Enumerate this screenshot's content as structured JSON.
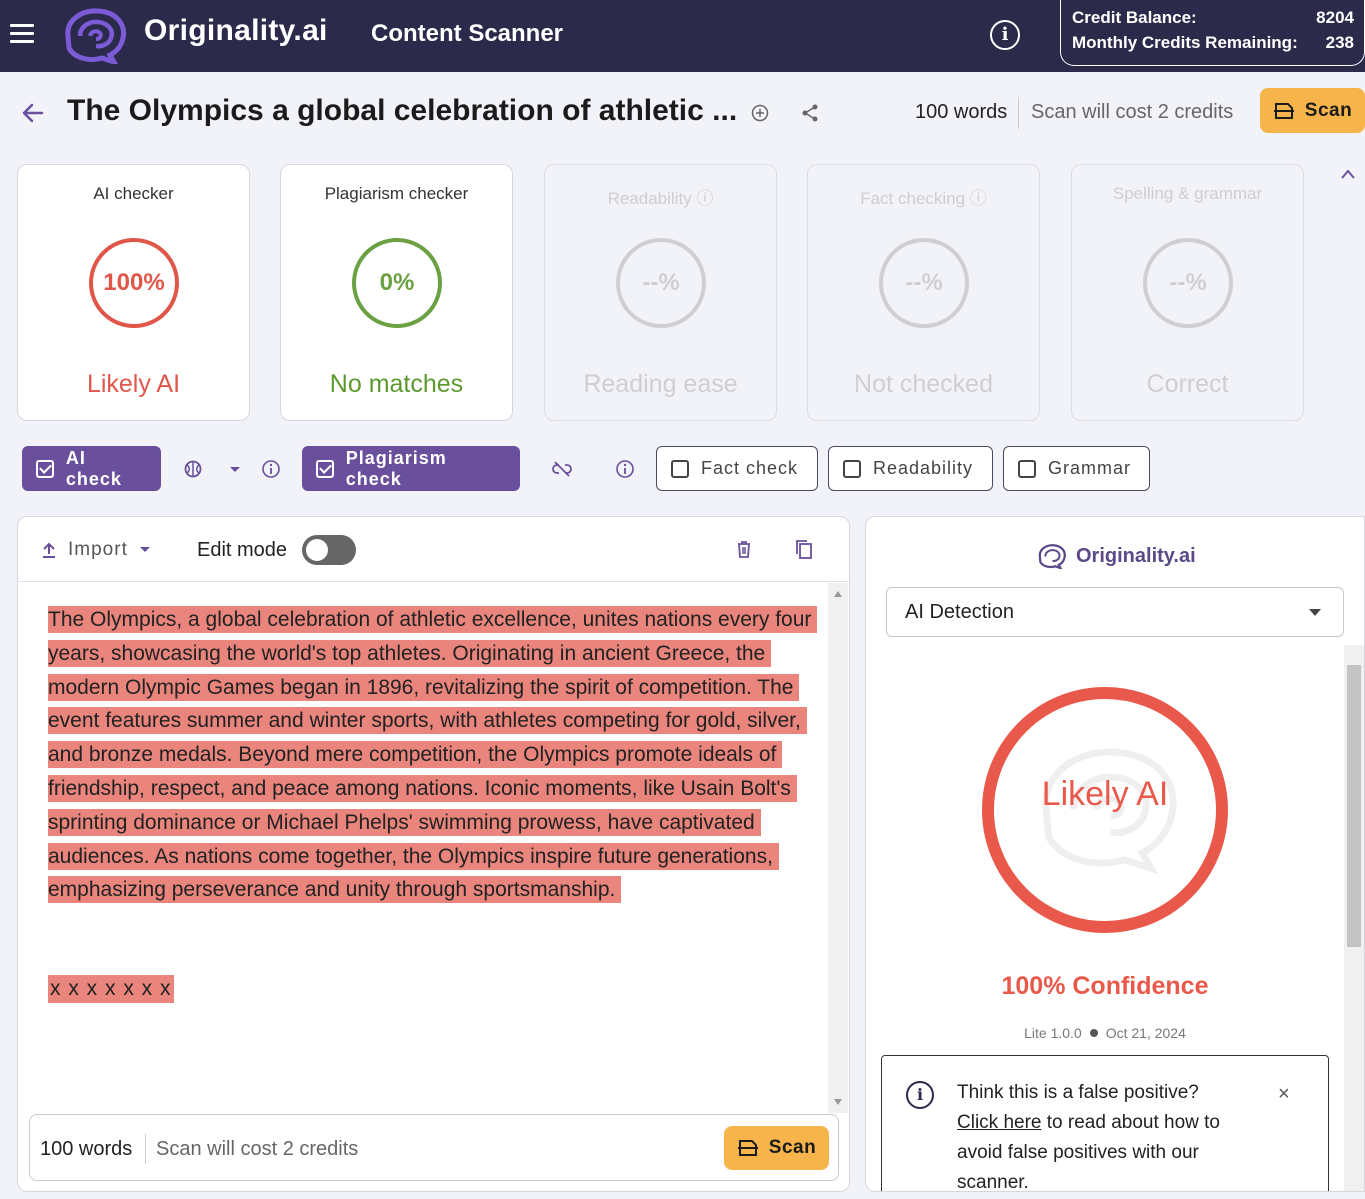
{
  "header": {
    "brand": "Originality.ai",
    "app_title": "Content Scanner",
    "credit_balance_label": "Credit Balance:",
    "credit_balance_value": "8204",
    "monthly_credits_label": "Monthly Credits Remaining:",
    "monthly_credits_value": "238"
  },
  "title_bar": {
    "doc_title": "The Olympics a global celebration of athletic ...",
    "word_count": "100 words",
    "scan_cost": "Scan will cost 2 credits",
    "scan_label": "Scan"
  },
  "cards": [
    {
      "title": "AI checker",
      "score": "100%",
      "label": "Likely AI",
      "state": "red"
    },
    {
      "title": "Plagiarism checker",
      "score": "0%",
      "label": "No matches",
      "state": "green"
    },
    {
      "title": "Readability ⓘ",
      "score": "--%",
      "label": "Reading ease",
      "state": "grey"
    },
    {
      "title": "Fact checking ⓘ",
      "score": "--%",
      "label": "Not checked",
      "state": "grey"
    },
    {
      "title": "Spelling & grammar",
      "score": "--%",
      "label": "Correct",
      "state": "grey"
    }
  ],
  "checks": {
    "ai_check": "AI check",
    "plagiarism_check": "Plagiarism check",
    "fact_check": "Fact check",
    "readability": "Readability",
    "grammar": "Grammar"
  },
  "editor": {
    "import_label": "Import",
    "edit_mode_label": "Edit mode",
    "edit_mode_on": false,
    "content": "The Olympics, a global celebration of athletic excellence, unites nations every four years, showcasing the world's top athletes. Originating in ancient Greece, the modern Olympic Games began in 1896, revitalizing the spirit of competition. The event features summer and winter sports, with athletes competing for gold, silver, and bronze medals. Beyond mere competition, the Olympics promote ideals of friendship, respect, and peace among nations. Iconic moments, like Usain Bolt's sprinting dominance or Michael Phelps' swimming prowess, have captivated audiences. As nations come together, the Olympics inspire future generations, emphasizing perseverance and unity through sportsmanship.",
    "extra_line": "x x x x x x x",
    "footer_words": "100 words",
    "footer_cost": "Scan will cost 2 credits",
    "footer_scan": "Scan"
  },
  "results_panel": {
    "brand": "Originality.ai",
    "detection_type": "AI Detection",
    "verdict": "Likely AI",
    "confidence": "100% Confidence",
    "model": "Lite 1.0.0",
    "date": "Oct 21, 2024",
    "fp_title": "Think this is a false positive?",
    "fp_link": "Click here",
    "fp_rest": " to read about how to avoid false positives with our scanner.",
    "close_symbol": "×"
  },
  "colors": {
    "header_bg": "#2c2a4b",
    "accent_purple": "#6a4f9c",
    "scan_orange": "#f6b44a",
    "ai_red": "#e9594b",
    "highlight": "#e9857c",
    "match_green": "#6ba043"
  }
}
